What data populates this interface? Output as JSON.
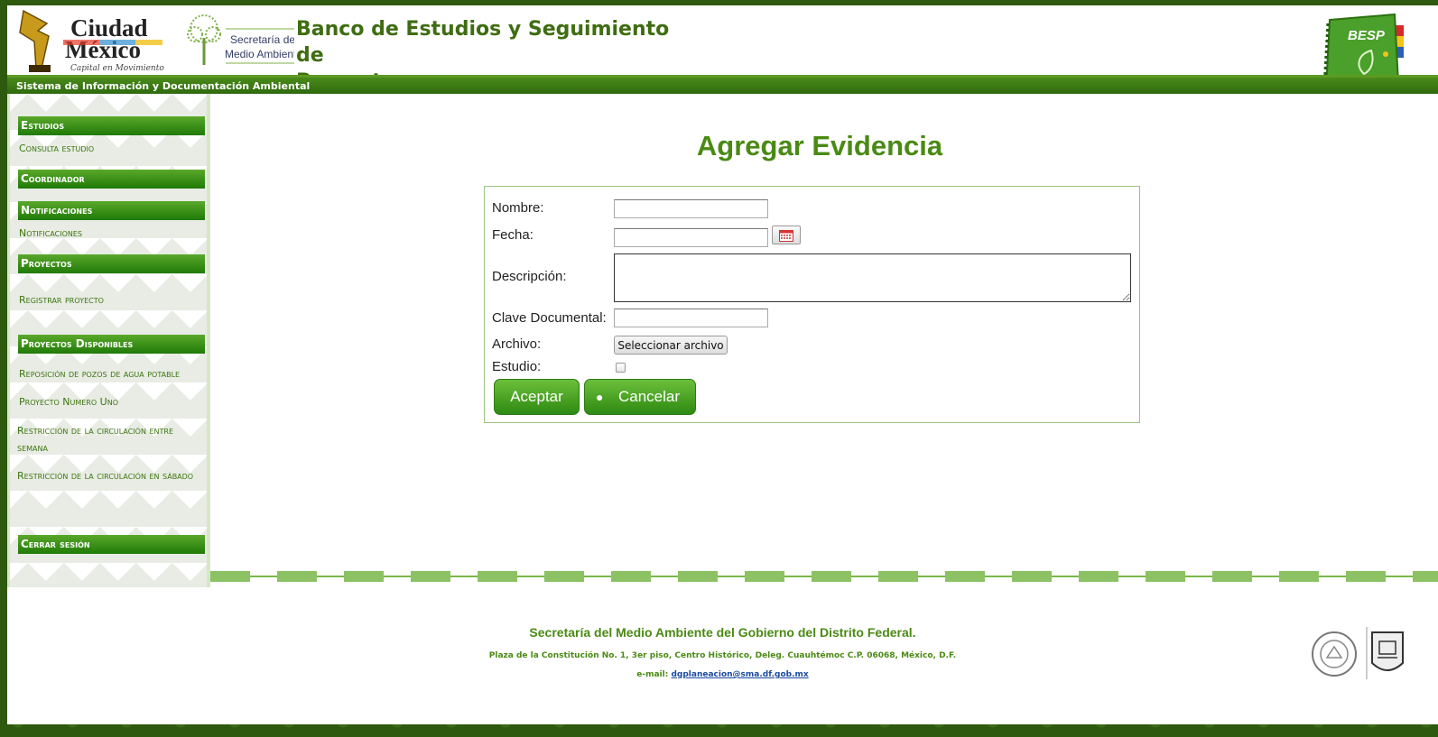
{
  "header": {
    "logo_cdmx_line1": "Ciudad",
    "logo_cdmx_line2": "México",
    "logo_cdmx_tagline": "Capital en Movimiento",
    "logo_sma_line1": "Secretaría del",
    "logo_sma_line2": "Medio Ambiente",
    "title_line1": "Banco de Estudios y Seguimiento de",
    "title_line2": "Proyectos",
    "besp_label": "BESP",
    "subtitle": "Sistema de Información y Documentación Ambiental"
  },
  "sidebar": {
    "sections": [
      {
        "title": "Estudios"
      },
      {
        "title": "Coordinador"
      },
      {
        "title": "Notificaciones"
      },
      {
        "title": "Proyectos"
      },
      {
        "title": "Proyectos Disponibles"
      },
      {
        "title": "Cerrar sesión"
      }
    ],
    "links": {
      "consulta_estudio": "Consulta estudio",
      "notificaciones": "Notificaciones",
      "registrar_proyecto": "Registrar proyecto",
      "proyecto_1": "Reposición de pozos de agua potable",
      "proyecto_2": "Proyecto Numero Uno",
      "proyecto_3": "Restricción de la circulación entre semana",
      "proyecto_4": "Restricción de la circulación en sábado"
    }
  },
  "main": {
    "title": "Agregar Evidencia",
    "form": {
      "nombre_label": "Nombre:",
      "nombre_value": "",
      "fecha_label": "Fecha:",
      "fecha_value": "",
      "descripcion_label": "Descripción:",
      "descripcion_value": "",
      "clave_label": "Clave Documental:",
      "clave_value": "",
      "archivo_label": "Archivo:",
      "archivo_button": "Seleccionar archivo",
      "estudio_label": "Estudio:",
      "estudio_checked": false,
      "accept_button": "Aceptar",
      "cancel_button": "Cancelar"
    }
  },
  "footer": {
    "line1": "Secretaría del Medio Ambiente del Gobierno del Distrito Federal.",
    "line2": "Plaza de la Constitución No. 1, 3er piso, Centro Histórico, Deleg. Cuauhtémoc C.P. 06068, México, D.F.",
    "email_label": "e-mail:",
    "email": "dgplaneacion@sma.df.gob.mx"
  },
  "colors": {
    "brand_green": "#4a8a14",
    "menu_green": "#1f7a08",
    "background": "#2e5a0f"
  }
}
